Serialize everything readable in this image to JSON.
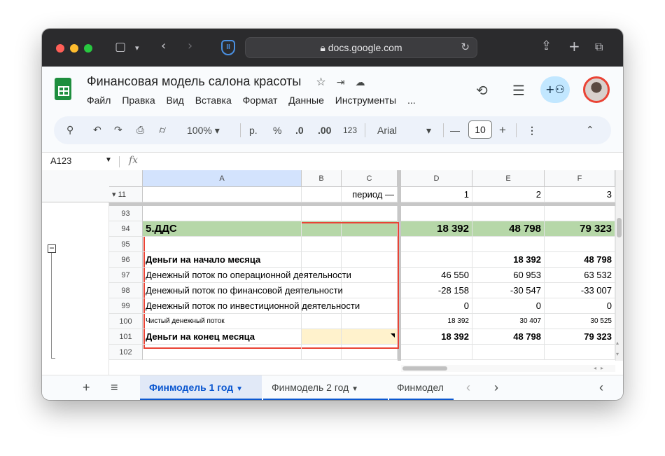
{
  "browser": {
    "url": "docs.google.com",
    "lock_icon": "lock-icon",
    "colors": {
      "close": "#ff5f57",
      "minimize": "#febc2e",
      "zoom": "#28c840"
    }
  },
  "doc": {
    "title": "Финансовая модель салона красоты",
    "menu": [
      "Файл",
      "Правка",
      "Вид",
      "Вставка",
      "Формат",
      "Данные",
      "Инструменты",
      "..."
    ]
  },
  "toolbar": {
    "zoom": "100%",
    "currency": "р.",
    "percent": "%",
    "dec_decrease": ".0",
    "dec_increase": ".00",
    "format_123": "123",
    "font": "Arial",
    "font_size": "10",
    "minus": "—",
    "plus": "+"
  },
  "formula_bar": {
    "cell_ref": "A123",
    "fx": "fx",
    "value": ""
  },
  "grid": {
    "columns": [
      "A",
      "B",
      "C",
      "D",
      "E",
      "F"
    ],
    "frozen_row": {
      "number": "11",
      "c": "период —",
      "d": "1",
      "e": "2",
      "f": "3"
    },
    "rows": [
      {
        "number": "93",
        "a": "",
        "d": "",
        "e": "",
        "f": ""
      },
      {
        "number": "94",
        "a": "5.ДДС",
        "d": "18 392",
        "e": "48 798",
        "f": "79 323"
      },
      {
        "number": "95",
        "a": "",
        "d": "",
        "e": "",
        "f": ""
      },
      {
        "number": "96",
        "a": "Деньги на начало месяца",
        "d": "",
        "e": "18 392",
        "f": "48 798"
      },
      {
        "number": "97",
        "a": "Денежный поток по операционной деятельности",
        "d": "46 550",
        "e": "60 953",
        "f": "63 532"
      },
      {
        "number": "98",
        "a": "Денежный поток по финансовой деятельности",
        "d": "-28 158",
        "e": "-30 547",
        "f": "-33 007"
      },
      {
        "number": "99",
        "a": "Денежный поток по инвестиционной деятельности",
        "d": "0",
        "e": "0",
        "f": "0"
      },
      {
        "number": "100",
        "a": "Чистый денежный поток",
        "d": "18 392",
        "e": "30 407",
        "f": "30 525"
      },
      {
        "number": "101",
        "a": "Деньги на конец месяца",
        "d": "18 392",
        "e": "48 798",
        "f": "79 323"
      },
      {
        "number": "102",
        "a": "",
        "d": "",
        "e": "",
        "f": ""
      }
    ],
    "highlight_color": "#ea4335",
    "green_fill": "#b6d7a8",
    "cream_fill": "#fff2cc"
  },
  "sheets": {
    "add": "+",
    "list": "≡",
    "tabs": [
      "Финмодель 1 год",
      "Финмодель 2 год",
      "Финмодел"
    ],
    "prev": "‹",
    "next": "›",
    "collapse": "‹"
  }
}
